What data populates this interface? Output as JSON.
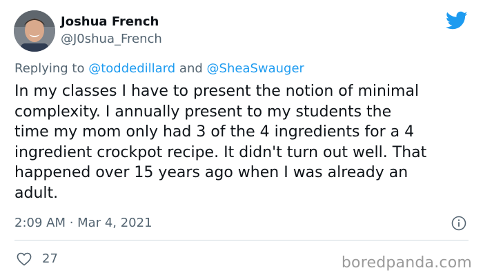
{
  "author": {
    "name": "Joshua French",
    "handle": "@J0shua_French"
  },
  "reply": {
    "prefix": "Replying to",
    "mention_1": "@toddedillard",
    "connector": "and",
    "mention_2": "@SheaSwauger"
  },
  "tweet": {
    "text": "In my classes I have to present the notion of minimal\ncomplexity. I annually present to my students the\ntime my mom only had 3 of the 4 ingredients for a 4\ningredient crockpot recipe. It didn't turn out well. That\nhappened over 15 years ago when I was already an\nadult.",
    "timestamp": "2:09 AM · Mar 4, 2021",
    "likes": "27"
  },
  "icons": {
    "brand": "twitter-bird-icon",
    "info": "info-icon",
    "like": "heart-icon"
  },
  "colors": {
    "twitter_blue": "#1d9bf0",
    "secondary_text": "#536471",
    "primary_text": "#0f1419",
    "divider": "#cfd9de",
    "watermark": "#9a9a9a"
  },
  "watermark": "boredpanda.com"
}
